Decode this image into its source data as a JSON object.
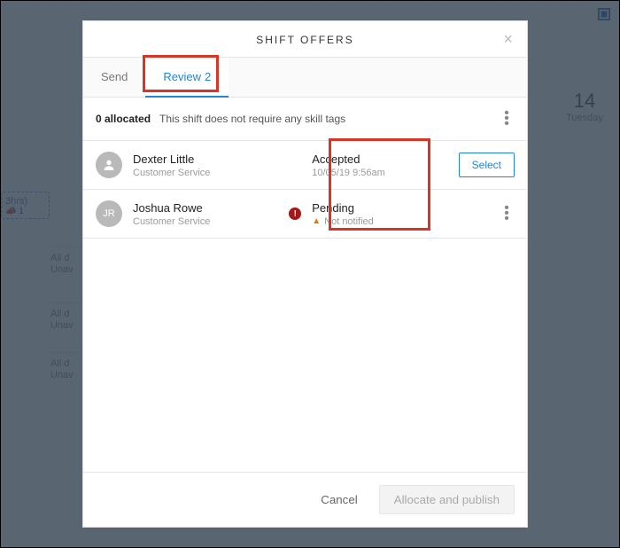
{
  "background": {
    "right_col": {
      "date_num": "14",
      "day": "Tuesday"
    },
    "left": {
      "hours": "3hrs)",
      "bell_count": "1"
    },
    "rows": [
      {
        "l1": "All d",
        "l2": "Unav"
      },
      {
        "l1": "All d",
        "l2": "Unav"
      },
      {
        "l1": "All d",
        "l2": "Unav"
      }
    ]
  },
  "modal": {
    "title": "SHIFT OFFERS",
    "tabs": {
      "send": "Send",
      "review": "Review",
      "review_count": "2"
    },
    "info": {
      "allocated": "0 allocated",
      "msg": "This shift does not require any skill tags"
    },
    "rows": [
      {
        "avatar_initials": "",
        "name": "Dexter Little",
        "role": "Customer Service",
        "has_alert": false,
        "status": "Accepted",
        "substatus": "10/05/19  9:56am",
        "has_warning": false,
        "action_type": "button",
        "action_label": "Select"
      },
      {
        "avatar_initials": "JR",
        "name": "Joshua Rowe",
        "role": "Customer Service",
        "has_alert": true,
        "alert_glyph": "!",
        "status": "Pending",
        "substatus": "Not notified",
        "has_warning": true,
        "action_type": "kebab"
      }
    ],
    "footer": {
      "cancel": "Cancel",
      "primary": "Allocate and publish"
    }
  }
}
